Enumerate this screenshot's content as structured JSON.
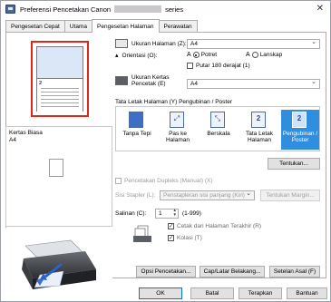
{
  "window": {
    "title_prefix": "Preferensi Pencetakan Canon",
    "title_suffix": "series"
  },
  "tabs": [
    {
      "label": "Pengesetan Cepat"
    },
    {
      "label": "Utama"
    },
    {
      "label": "Pengesetan Halaman"
    },
    {
      "label": "Perawatan"
    }
  ],
  "left": {
    "preview_page_number": "2",
    "media_type": "Kertas Biasa",
    "media_size": "A4"
  },
  "page_setup": {
    "page_size_label": "Ukuran Halaman (Z):",
    "page_size_value": "A4",
    "orientation_label": "Orientasi (O):",
    "portrait_label": "Potret",
    "landscape_label": "Lanskap",
    "rotate_label": "Putar 180 derajat (1)",
    "paper_size_label": "Ukuran Kertas Pencetak (E)",
    "paper_size_value": "A4"
  },
  "layout": {
    "group_label": "Tata Letak Halaman (Y) Pengubinan / Poster",
    "items": [
      {
        "label1": "Tanpa Tepi",
        "label2": "",
        "glyph": "▢"
      },
      {
        "label1": "Pas ke",
        "label2": "Halaman",
        "glyph": "⤢"
      },
      {
        "label1": "Berskala",
        "label2": "",
        "glyph": "⤡"
      },
      {
        "label1": "Tata Letak",
        "label2": "Halaman",
        "glyph": "2"
      },
      {
        "label1": "Pengubinan /",
        "label2": "Poster",
        "glyph": "2"
      }
    ],
    "specify_button": "Tentukan..."
  },
  "duplex": {
    "checkbox_label": "Pencetakan Dupleks (Manual) (X)",
    "stapling_label": "Sisi Stapler (L):",
    "stapling_value": "Penstapleran sisi panjang (Kiri)",
    "margin_button": "Tentukan Margin..."
  },
  "copies": {
    "label": "Salinan (C):",
    "value": "1",
    "range": "(1-999)",
    "print_last_label": "Cetak dari Halaman Terakhir (R)",
    "collate_label": "Kolasi (T)"
  },
  "footer_buttons": {
    "print_options": "Opsi Pencetakan...",
    "stamp": "Cap/Latar Belakang...",
    "defaults": "Setelan Asal (F)",
    "ok": "OK",
    "cancel": "Batal",
    "apply": "Terapkan",
    "help": "Bantuan"
  }
}
